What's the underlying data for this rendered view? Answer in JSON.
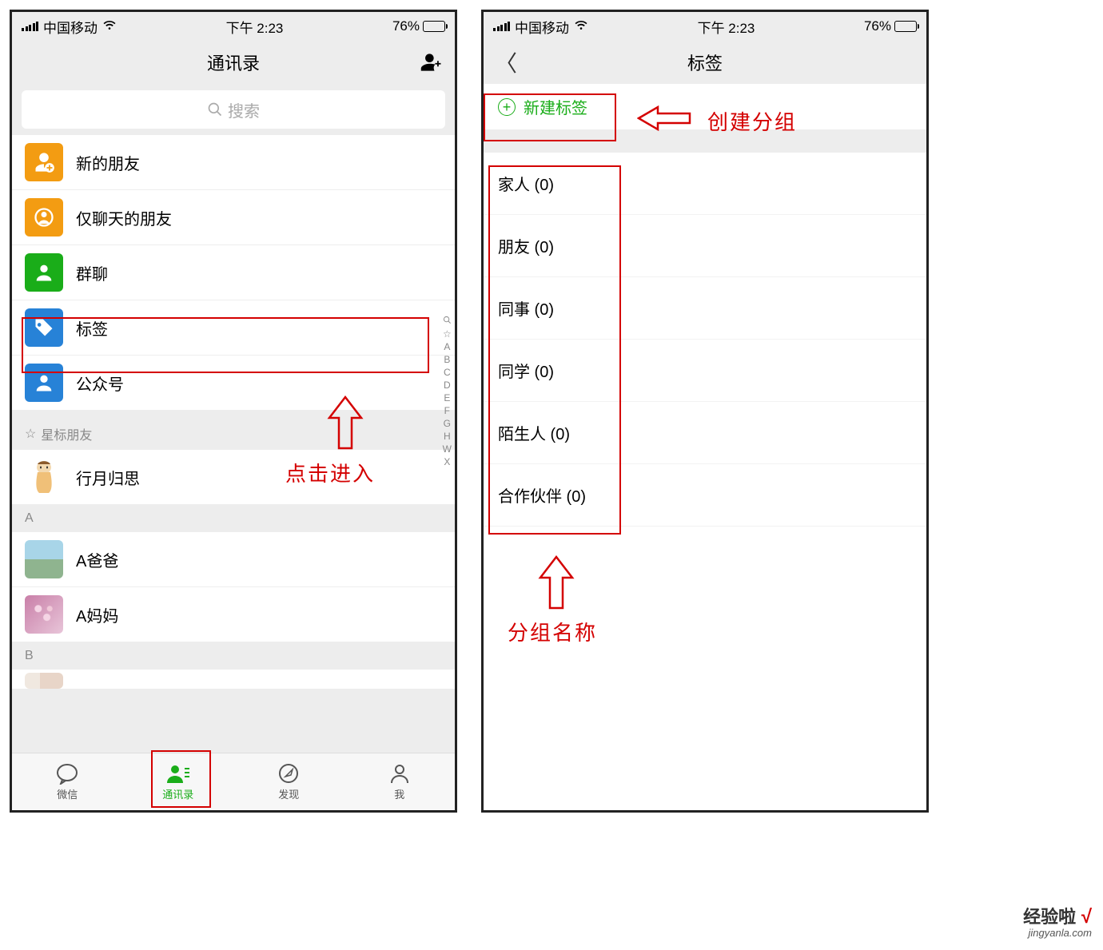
{
  "status": {
    "carrier": "中国移动",
    "time": "下午 2:23",
    "battery_pct": "76%"
  },
  "left": {
    "title": "通讯录",
    "search_placeholder": "搜索",
    "menu": [
      {
        "label": "新的朋友"
      },
      {
        "label": "仅聊天的朋友"
      },
      {
        "label": "群聊"
      },
      {
        "label": "标签"
      },
      {
        "label": "公众号"
      }
    ],
    "star_header": "星标朋友",
    "star_contact": "行月归思",
    "section_a": "A",
    "contacts_a": [
      "A爸爸",
      "A妈妈"
    ],
    "section_b": "B",
    "index": [
      "☆",
      "A",
      "B",
      "C",
      "D",
      "E",
      "F",
      "G",
      "H",
      "W",
      "X"
    ],
    "tabs": [
      "微信",
      "通讯录",
      "发现",
      "我"
    ],
    "annot_enter": "点击进入"
  },
  "right": {
    "title": "标签",
    "new_tag": "新建标签",
    "tags": [
      {
        "name": "家人",
        "count": 0
      },
      {
        "name": "朋友",
        "count": 0
      },
      {
        "name": "同事",
        "count": 0
      },
      {
        "name": "同学",
        "count": 0
      },
      {
        "name": "陌生人",
        "count": 0
      },
      {
        "name": "合作伙伴",
        "count": 0
      }
    ],
    "annot_create": "创建分组",
    "annot_group_name": "分组名称"
  },
  "watermark": {
    "cn": "经验啦",
    "en": "jingyanla.com"
  }
}
